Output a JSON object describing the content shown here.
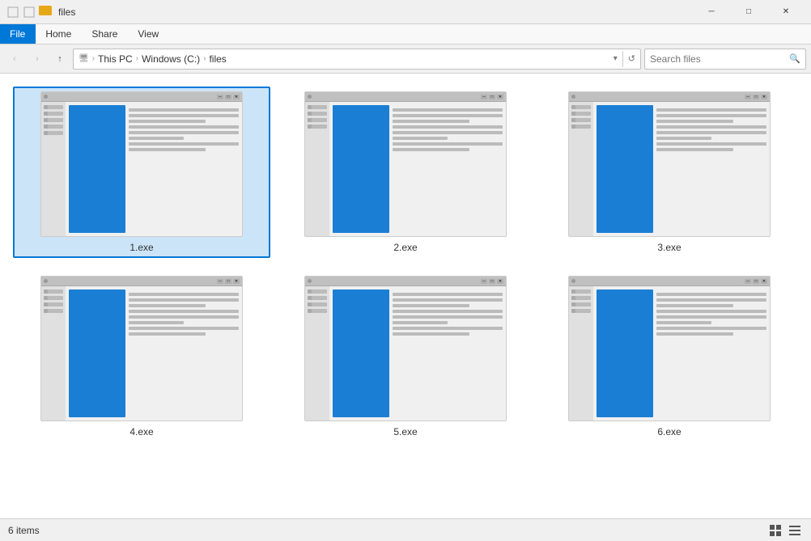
{
  "titlebar": {
    "title": "files",
    "controls": {
      "minimize": "─",
      "maximize": "□",
      "close": "✕"
    }
  },
  "ribbon": {
    "tabs": [
      {
        "id": "file",
        "label": "File",
        "active": true
      },
      {
        "id": "home",
        "label": "Home",
        "active": false
      },
      {
        "id": "share",
        "label": "Share",
        "active": false
      },
      {
        "id": "view",
        "label": "View",
        "active": false
      }
    ]
  },
  "nav": {
    "back_label": "‹",
    "forward_label": "›",
    "up_label": "↑",
    "breadcrumb": [
      {
        "id": "this-pc",
        "label": "This PC"
      },
      {
        "id": "windows-c",
        "label": "Windows (C:)"
      },
      {
        "id": "files",
        "label": "files"
      }
    ],
    "refresh_label": "↺",
    "search_placeholder": "Search files"
  },
  "files": [
    {
      "id": "1",
      "name": "1.exe",
      "selected": true
    },
    {
      "id": "2",
      "name": "2.exe",
      "selected": false
    },
    {
      "id": "3",
      "name": "3.exe",
      "selected": false
    },
    {
      "id": "4",
      "name": "4.exe",
      "selected": false
    },
    {
      "id": "5",
      "name": "5.exe",
      "selected": false
    },
    {
      "id": "6",
      "name": "6.exe",
      "selected": false
    }
  ],
  "statusbar": {
    "item_count": "6 items"
  }
}
